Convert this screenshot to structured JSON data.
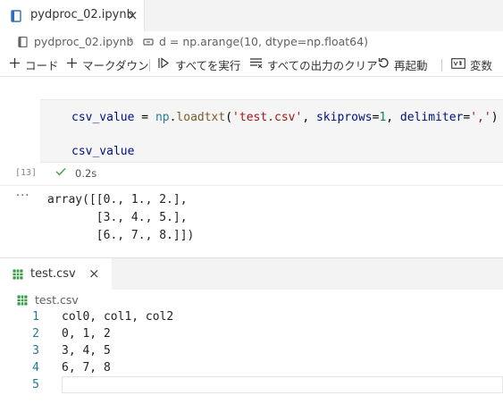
{
  "notebook_tab": {
    "title": "pydproc_02.ipynb",
    "close": "×"
  },
  "breadcrumb": {
    "file": "pydproc_02.ipynb",
    "separator": "›",
    "cell": "d = np.arange(10, dtype=np.float64)"
  },
  "toolbar": {
    "add_code": "コード",
    "add_markdown": "マークダウン",
    "run_all": "すべてを実行",
    "clear_outputs": "すべての出力のクリア",
    "restart": "再起動",
    "variables": "変数"
  },
  "cell": {
    "line1": {
      "var": "csv_value",
      "eq": " = ",
      "mod": "np",
      "dot": ".",
      "fn": "loadtxt",
      "open": "(",
      "arg1": "'test.csv'",
      "comma1": ", ",
      "kw1": "skiprows",
      "eq1": "=",
      "num1": "1",
      "comma2": ", ",
      "kw2": "delimiter",
      "eq2": "=",
      "arg2": "','",
      "close": ")"
    },
    "line2": "csv_value",
    "execution_count": "[13]",
    "duration": "0.2s"
  },
  "output": {
    "more": "···",
    "text": "array([[0., 1., 2.],\n       [3., 4., 5.],\n       [6., 7., 8.]])"
  },
  "csv_editor": {
    "tab_title": "test.csv",
    "close": "×",
    "crumb": "test.csv",
    "lines": [
      {
        "num": "1",
        "text": "col0, col1, col2"
      },
      {
        "num": "2",
        "text": "0, 1, 2"
      },
      {
        "num": "3",
        "text": "3, 4, 5"
      },
      {
        "num": "4",
        "text": "6, 7, 8"
      },
      {
        "num": "5",
        "text": ""
      }
    ]
  },
  "colors": {
    "accent_check": "#4b9b4b",
    "csv_icon": "#3a9a4a",
    "line_number": "#237893",
    "string": "#a31515",
    "number": "#098658",
    "function": "#795e26"
  }
}
